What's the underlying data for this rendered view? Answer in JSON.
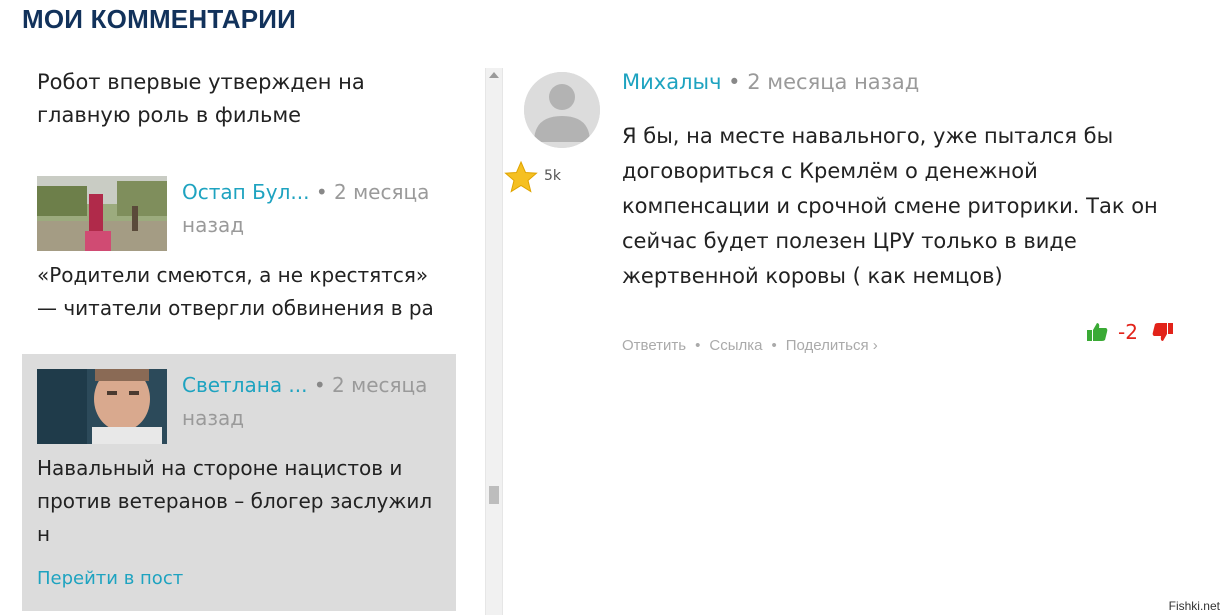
{
  "page": {
    "title": "МОИ КОММЕНТАРИИ"
  },
  "list": {
    "top_post_title": "Робот впервые утвержден на главную роль в фильме",
    "items": [
      {
        "author": "Остап Бул...",
        "dot": "•",
        "time": "2 месяца назад",
        "post_title": "«Родители смеются, а не крестятся» — читатели отвергли обвинения в ра"
      },
      {
        "author": "Светлана ...",
        "dot": "•",
        "time": "2 месяца назад",
        "post_title": "Навальный на стороне нацистов и против ветеранов – блогер заслужил н",
        "link": "Перейти в пост"
      }
    ]
  },
  "comment": {
    "author": "Михалыч",
    "dot": "•",
    "time": "2 месяца назад",
    "karma": "5k",
    "text": "Я бы, на месте навального, уже пытался бы договориться с Кремлём о денежной компенсации и срочной смене риторики. Так он сейчас будет полезен ЦРУ только в виде жертвенной коровы ( как немцов)",
    "actions": {
      "reply": "Ответить",
      "link": "Ссылка",
      "share": "Поделиться ›",
      "sep": "•"
    },
    "score": "-2"
  },
  "watermark": "Fishki.net",
  "colors": {
    "title": "#12325b",
    "accent": "#1ea3c0",
    "muted": "#9a9a9a",
    "upvote": "#3aaa35",
    "downvote": "#e2231a",
    "highlight": "#dcdcdc"
  }
}
